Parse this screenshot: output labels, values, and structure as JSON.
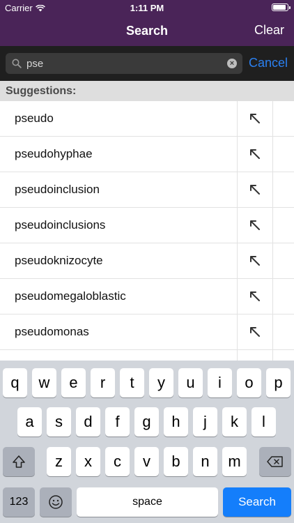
{
  "status": {
    "carrier": "Carrier",
    "time": "1:11 PM",
    "battery_level": 0.9
  },
  "nav": {
    "title": "Search",
    "clear_label": "Clear"
  },
  "search": {
    "value": "pse",
    "cancel_label": "Cancel"
  },
  "suggestions": {
    "header": "Suggestions:",
    "items": [
      "pseudo",
      "pseudohyphae",
      "pseudoinclusion",
      "pseudoinclusions",
      "pseudoknizocyte",
      "pseudomegaloblastic",
      "pseudomonas"
    ]
  },
  "keyboard": {
    "row1": [
      "q",
      "w",
      "e",
      "r",
      "t",
      "y",
      "u",
      "i",
      "o",
      "p"
    ],
    "row2": [
      "a",
      "s",
      "d",
      "f",
      "g",
      "h",
      "j",
      "k",
      "l"
    ],
    "row3": [
      "z",
      "x",
      "c",
      "v",
      "b",
      "n",
      "m"
    ],
    "numbers_label": "123",
    "space_label": "space",
    "search_label": "Search"
  }
}
